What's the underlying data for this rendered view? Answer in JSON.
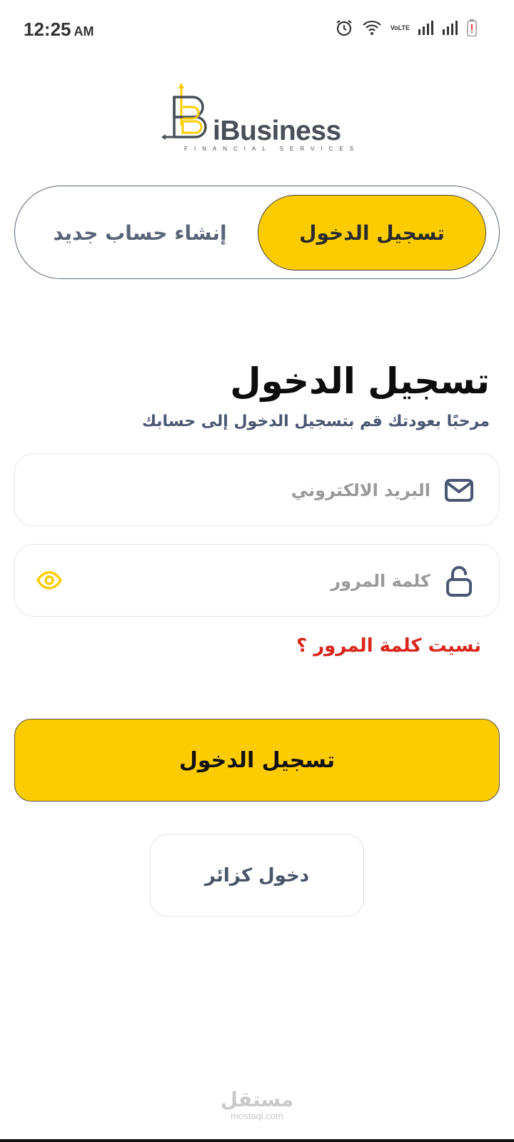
{
  "status_bar": {
    "time": "12:25",
    "ampm": "AM",
    "volte_top": "Vo",
    "volte_bottom": "LTE",
    "icons": [
      "alarm-icon",
      "wifi-icon",
      "volte-icon",
      "signal-icon",
      "signal-icon",
      "battery-low-icon"
    ]
  },
  "logo": {
    "wordmark": "iBusiness",
    "tagline": "FINANCIAL SERVICES",
    "accent_color": "#fdcc00"
  },
  "tabs": {
    "login": "تسجيل الدخول",
    "register": "إنشاء حساب جديد",
    "active": "login"
  },
  "page": {
    "title": "تسجيل الدخول",
    "subtitle": "مرحبًا بعودتك قم بتسجيل الدخول إلى حسابك"
  },
  "form": {
    "email": {
      "placeholder": "البريد الالكتروني",
      "value": "",
      "icon": "mail-icon"
    },
    "password": {
      "placeholder": "كلمة المرور",
      "value": "",
      "icon": "unlock-icon",
      "toggle_icon": "eye-icon"
    },
    "forgot": "نسيت كلمة المرور ؟"
  },
  "actions": {
    "login": "تسجيل الدخول",
    "guest": "دخول كزائر"
  },
  "watermark": {
    "arabic": "مستقل",
    "latin": "mostaqi.com"
  },
  "colors": {
    "primary": "#fdcc00",
    "danger": "#d9261c",
    "muted_text": "#4a5673"
  }
}
